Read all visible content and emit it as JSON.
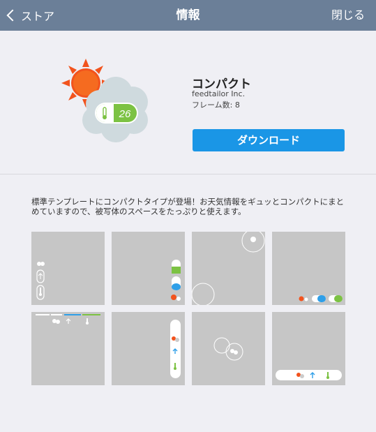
{
  "nav": {
    "back_label": "ストア",
    "title": "情報",
    "close_label": "閉じる"
  },
  "app": {
    "name": "コンパクト",
    "developer": "feedtailor Inc.",
    "frames": "フレーム数: 8",
    "icon_temperature": "26",
    "download_label": "ダウンロード"
  },
  "description": "標準テンプレートにコンパクトタイプが登場！お天気情報をギュッとコンパクトにまとめていますので、被写体のスペースをたっぷりと使えます。",
  "colors": {
    "navbar": "#6b7f98",
    "download_button": "#1a96e6",
    "thumbnail_bg": "#c6c6c6",
    "icon_green": "#7cc243",
    "icon_blue": "#2f9fe8",
    "icon_sun": "#f2531d"
  },
  "frames": [
    {
      "id": "frame-1"
    },
    {
      "id": "frame-2"
    },
    {
      "id": "frame-3"
    },
    {
      "id": "frame-4"
    },
    {
      "id": "frame-5"
    },
    {
      "id": "frame-6"
    },
    {
      "id": "frame-7"
    },
    {
      "id": "frame-8"
    }
  ]
}
